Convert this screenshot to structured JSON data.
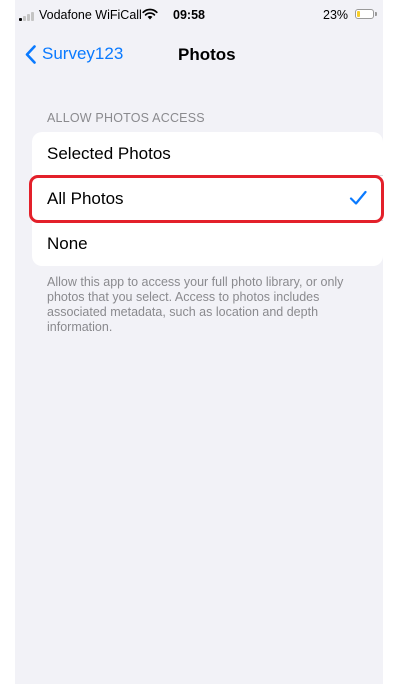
{
  "status_bar": {
    "carrier": "Vodafone WiFiCall",
    "time": "09:58",
    "battery_percent": "23%",
    "battery_level": 0.23,
    "battery_color": "#f7ce2b",
    "signal_bars_active": 1,
    "signal_icon": "signal-icon",
    "wifi_icon": "wifi-icon"
  },
  "nav": {
    "back_label": "Survey123",
    "back_icon": "chevron-left-icon",
    "title": "Photos"
  },
  "section": {
    "header": "ALLOW PHOTOS ACCESS",
    "options": [
      {
        "label": "Selected Photos",
        "selected": false
      },
      {
        "label": "All Photos",
        "selected": true
      },
      {
        "label": "None",
        "selected": false
      }
    ],
    "check_icon": "checkmark-icon",
    "footer": "Allow this app to access your full photo library, or only photos that you select. Access to photos includes associated metadata, such as location and depth information."
  },
  "colors": {
    "accent": "#0a7aff",
    "highlight": "#e3202a",
    "background": "#f2f2f7",
    "secondary_text": "#8a8a8e"
  }
}
